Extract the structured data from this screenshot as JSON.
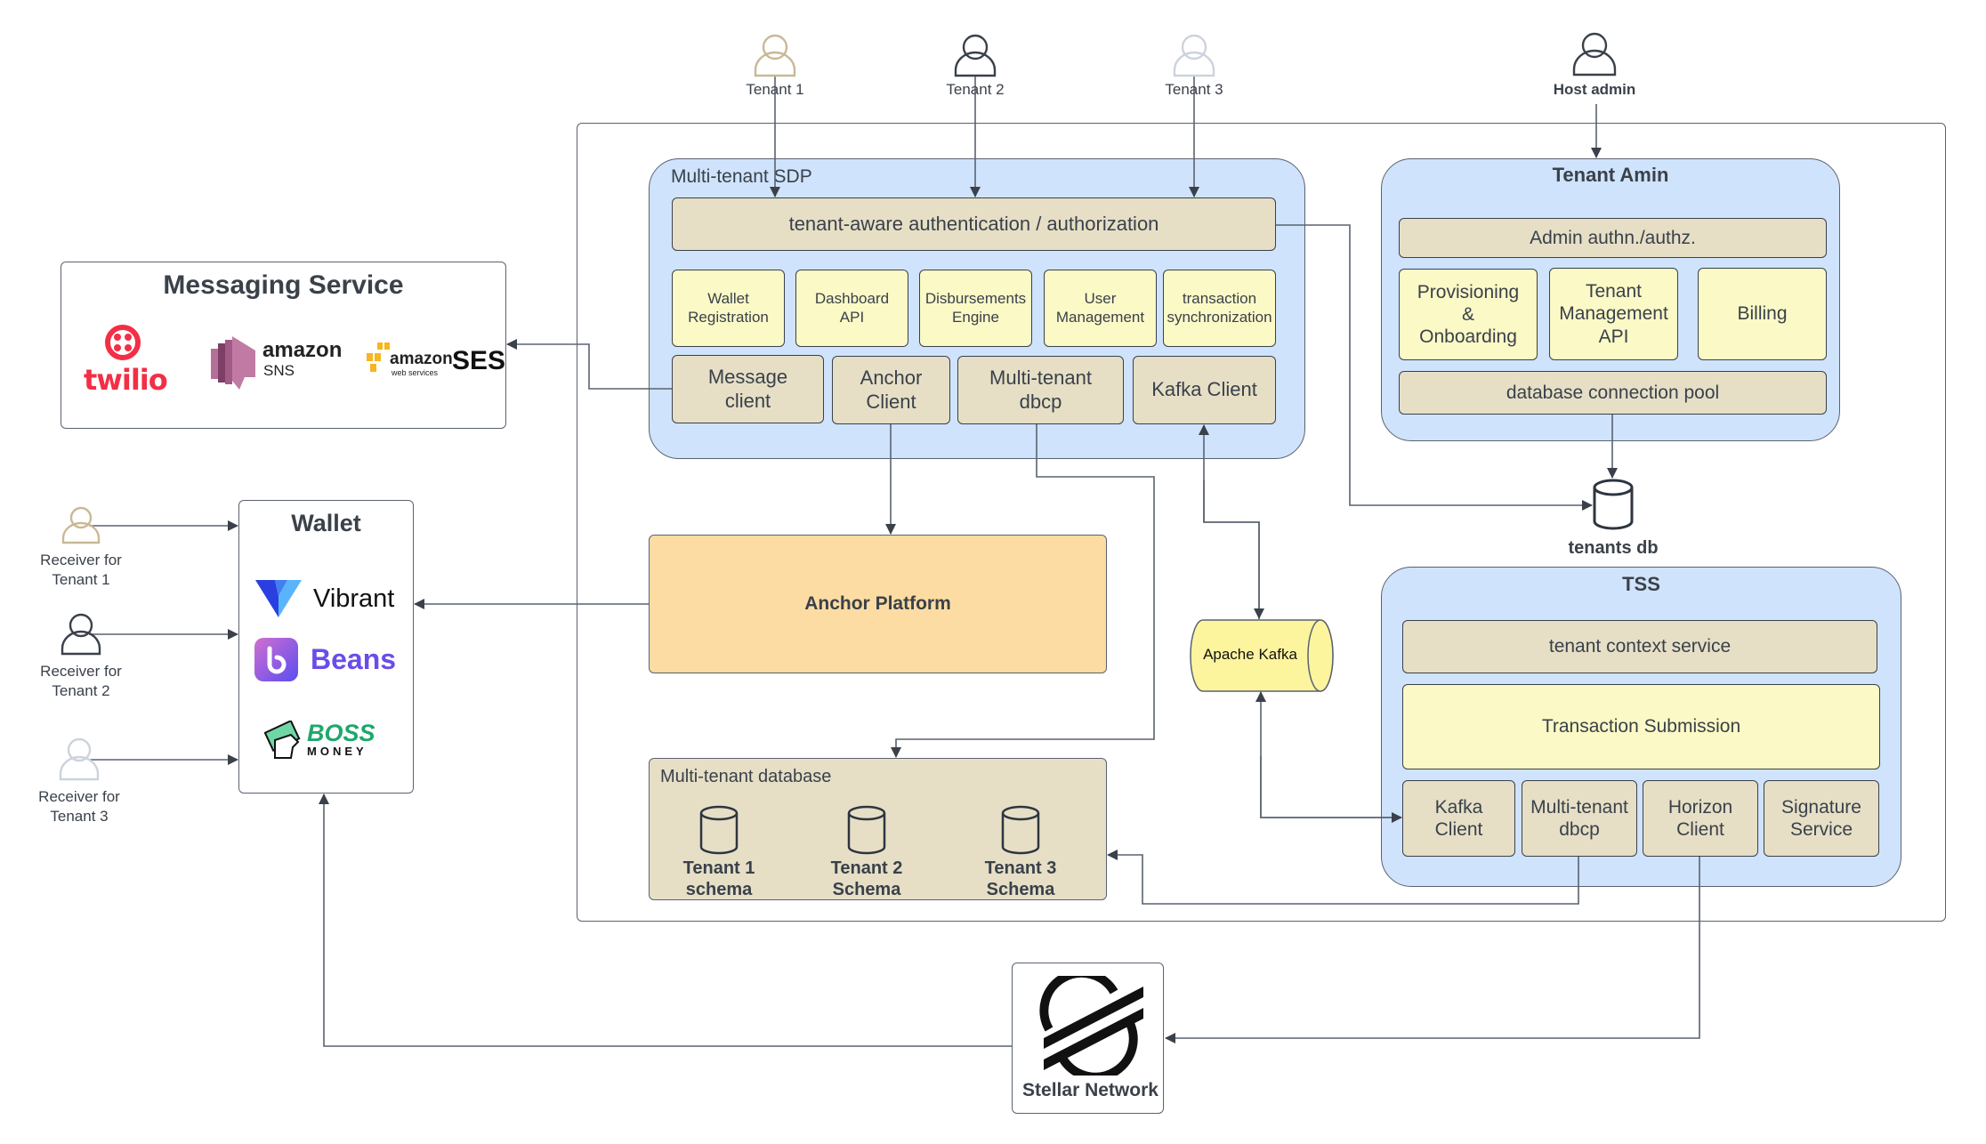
{
  "actors": {
    "tenant1": {
      "label": "Tenant 1",
      "color": "#c8b996"
    },
    "tenant2": {
      "label": "Tenant 2",
      "color": "#3a414a"
    },
    "tenant3": {
      "label": "Tenant 3",
      "color": "#cdd3dc"
    },
    "host_admin": {
      "label": "Host admin",
      "color": "#3a414a"
    },
    "receiver1": {
      "label_line1": "Receiver for",
      "label_line2": "Tenant 1",
      "color": "#c8b996"
    },
    "receiver2": {
      "label_line1": "Receiver for",
      "label_line2": "Tenant 2",
      "color": "#3a414a"
    },
    "receiver3": {
      "label_line1": "Receiver for",
      "label_line2": "Tenant 3",
      "color": "#cdd3dc"
    }
  },
  "sdp": {
    "title": "Multi-tenant SDP",
    "auth": "tenant-aware authentication / authorization",
    "modules": [
      {
        "line1": "Wallet",
        "line2": "Registration"
      },
      {
        "line1": "Dashboard",
        "line2": "API"
      },
      {
        "line1": "Disbursements",
        "line2": "Engine"
      },
      {
        "line1": "User",
        "line2": "Management"
      },
      {
        "line1": "transaction",
        "line2": "synchronization"
      }
    ],
    "clients": [
      {
        "line1": "Message",
        "line2": "client"
      },
      {
        "line1": "Anchor",
        "line2": "Client"
      },
      {
        "line1": "Multi-tenant",
        "line2": "dbcp"
      },
      {
        "line1": "Kafka Client",
        "line2": ""
      }
    ]
  },
  "tenant_admin": {
    "title": "Tenant Amin",
    "auth": "Admin authn./authz.",
    "modules": [
      {
        "line1": "Provisioning",
        "line2": "&",
        "line3": "Onboarding"
      },
      {
        "line1": "Tenant",
        "line2": "Management",
        "line3": "API"
      },
      {
        "line1": "Billing",
        "line2": "",
        "line3": ""
      }
    ],
    "pool": "database connection pool"
  },
  "tenants_db": {
    "label": "tenants db"
  },
  "tss": {
    "title": "TSS",
    "context": "tenant context service",
    "submission": "Transaction Submission",
    "clients": [
      {
        "line1": "Kafka",
        "line2": "Client"
      },
      {
        "line1": "Multi-tenant",
        "line2": "dbcp"
      },
      {
        "line1": "Horizon",
        "line2": "Client"
      },
      {
        "line1": "Signature",
        "line2": "Service"
      }
    ]
  },
  "messaging": {
    "title": "Messaging Service",
    "providers": [
      {
        "name": "twilio",
        "color": "#f22f46"
      },
      {
        "name": "amazon",
        "sub": "SNS",
        "color": "#b5709a"
      },
      {
        "name": "amazon",
        "sub": "web services",
        "product": "SES",
        "color": "#f7b521"
      }
    ]
  },
  "wallet": {
    "title": "Wallet",
    "providers": [
      {
        "name": "Vibrant",
        "color": "#2a55f0"
      },
      {
        "name": "Beans",
        "color": "#6a4de8"
      },
      {
        "name": "BOSS",
        "sub": "MONEY",
        "color": "#1fa86b"
      }
    ]
  },
  "anchor_platform": {
    "label": "Anchor Platform"
  },
  "kafka": {
    "label": "Apache Kafka"
  },
  "mt_database": {
    "title": "Multi-tenant database",
    "schemas": [
      {
        "line1": "Tenant 1",
        "line2": "schema"
      },
      {
        "line1": "Tenant 2",
        "line2": "Schema"
      },
      {
        "line1": "Tenant 3",
        "line2": "Schema"
      }
    ]
  },
  "stellar": {
    "label": "Stellar Network"
  },
  "colors": {
    "container_blue": "#cfe3fc",
    "component_tan": "#e6dfc6",
    "component_yellow": "#fbf9c6",
    "anchor_orange": "#fddca3",
    "kafka_yellow": "#fdf49e",
    "stroke": "#3a414a"
  }
}
